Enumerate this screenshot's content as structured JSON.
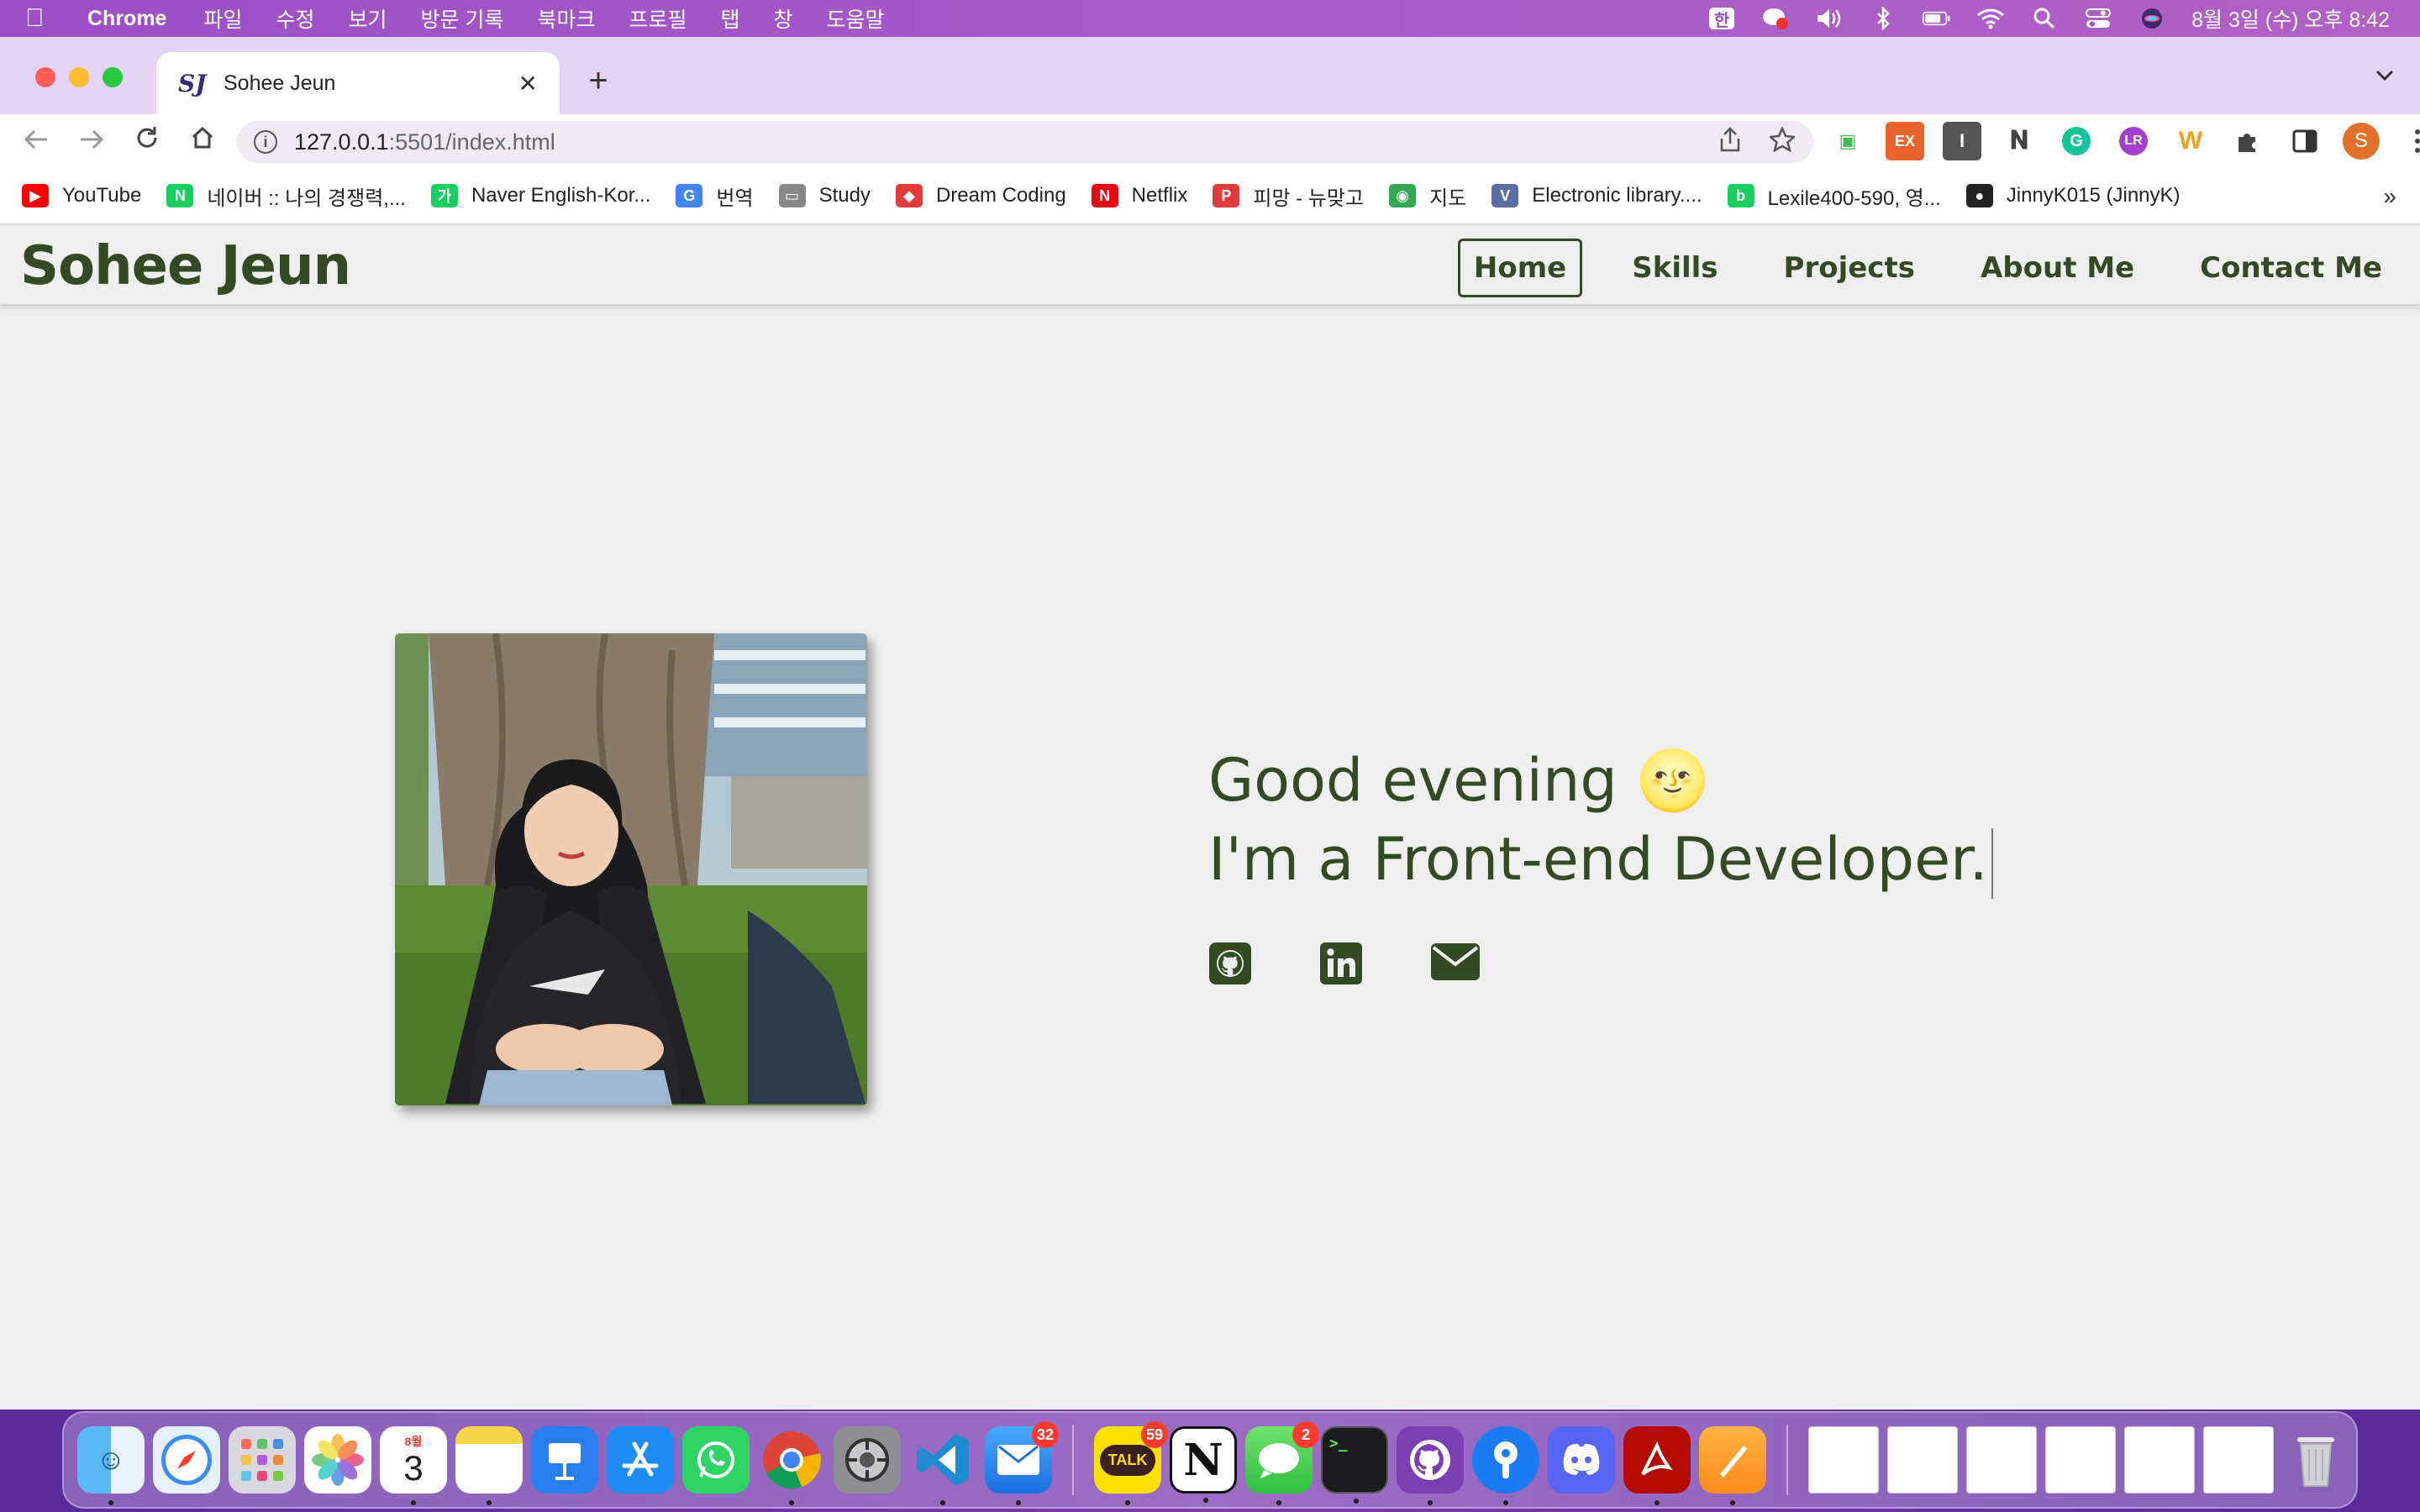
{
  "menubar": {
    "app_name": "Chrome",
    "items": [
      "파일",
      "수정",
      "보기",
      "방문 기록",
      "북마크",
      "프로필",
      "탭",
      "창",
      "도움말"
    ],
    "input_method": "한",
    "clock": "8월 3일 (수) 오후 8:42"
  },
  "tab": {
    "title": "Sohee Jeun",
    "favicon_text": "SJ"
  },
  "omnibox": {
    "url_host": "127.0.0.1",
    "url_path": ":5501/index.html"
  },
  "profile_initial": "S",
  "bookmarks": [
    {
      "label": "YouTube",
      "icon": "youtube-icon",
      "color": "#ff0000"
    },
    {
      "label": "네이버 :: 나의 경쟁력,...",
      "icon": "naver-icon",
      "color": "#19ce60"
    },
    {
      "label": "Naver English-Kor...",
      "icon": "naver-dict-icon",
      "color": "#19ce60"
    },
    {
      "label": "번역",
      "icon": "google-translate-icon",
      "color": "#4285f4"
    },
    {
      "label": "Study",
      "icon": "folder-icon",
      "color": "#888888"
    },
    {
      "label": "Dream Coding",
      "icon": "dream-coding-icon",
      "color": "#e33b3b"
    },
    {
      "label": "Netflix",
      "icon": "netflix-icon",
      "color": "#e50914"
    },
    {
      "label": "피망 - 뉴맞고",
      "icon": "pmang-icon",
      "color": "#e33b3b"
    },
    {
      "label": "지도",
      "icon": "maps-icon",
      "color": "#34a853"
    },
    {
      "label": "Electronic library....",
      "icon": "elibrary-icon",
      "color": "#5b6ea3"
    },
    {
      "label": "Lexile400-590, 영...",
      "icon": "blog-icon",
      "color": "#19ce60"
    },
    {
      "label": "JinnyK015 (JinnyK)",
      "icon": "github-icon",
      "color": "#222222"
    }
  ],
  "site": {
    "logo": "Sohee Jeun",
    "nav": [
      "Home",
      "Skills",
      "Projects",
      "About Me",
      "Contact Me"
    ],
    "active_nav": "Home",
    "greeting_line1": "Good evening 🌝",
    "greeting_line2": "I'm a Front-end Developer.",
    "socials": [
      "github-icon",
      "linkedin-icon",
      "email-icon"
    ],
    "brand_color": "#344a24"
  },
  "dock": {
    "badges": {
      "mail": "32",
      "kakaotalk": "59",
      "messages": "2"
    },
    "calendar_month": "8월",
    "calendar_day": "3",
    "kakao_label": "TALK"
  }
}
